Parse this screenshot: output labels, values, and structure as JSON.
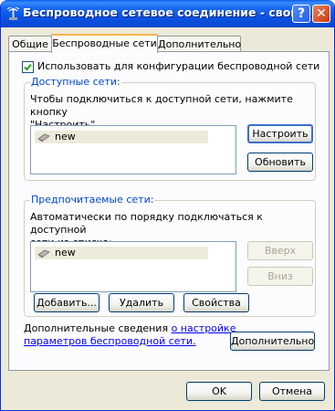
{
  "window": {
    "title": "Беспроводное сетевое соединение - свой...",
    "help_label": "?",
    "close_label": "✕"
  },
  "tabs": [
    {
      "label": "Общие",
      "active": false
    },
    {
      "label": "Беспроводные сети",
      "active": true
    },
    {
      "label": "Дополнительно",
      "active": false
    }
  ],
  "use_windows_checkbox": {
    "label": "Использовать для конфигурации беспроводной сети",
    "checked": true
  },
  "available_networks": {
    "legend": "Доступные сети:",
    "description_line1": "Чтобы подключиться к доступной сети, нажмите кнопку",
    "description_line2": "\"Настроить\".",
    "items": [
      {
        "name": "new",
        "icon": "wireless-network-icon"
      }
    ],
    "configure_label": "Настроить",
    "refresh_label": "Обновить"
  },
  "preferred_networks": {
    "legend": "Предпочитаемые сети:",
    "description_line1": "Автоматически по порядку подключаться к доступной",
    "description_line2": "сети из списка:",
    "items": [
      {
        "name": "new",
        "icon": "wireless-network-icon"
      }
    ],
    "up_label": "Вверх",
    "down_label": "Вниз",
    "add_label": "Добавить...",
    "remove_label": "Удалить",
    "properties_label": "Свойства"
  },
  "learn_more": {
    "text_prefix": "Дополнительные сведения",
    "link_line1": "о настройке",
    "link_line2": "параметров беспроводной сети.",
    "advanced_label": "Дополнительно"
  },
  "dialog_buttons": {
    "ok_label": "OK",
    "cancel_label": "Отмена"
  },
  "colors": {
    "title_bar": "#0a54e4",
    "legend_text": "#0046d5",
    "link": "#0000ff",
    "tab_highlight": "#f7b44b"
  }
}
